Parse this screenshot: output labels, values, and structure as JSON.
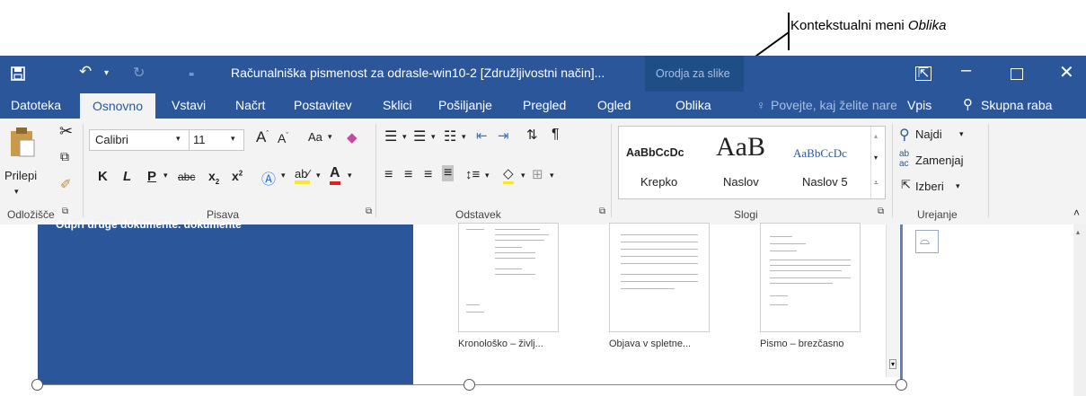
{
  "callout": {
    "prefix": "Kontekstualni meni ",
    "emphasis": "Oblika"
  },
  "titlebar": {
    "save_icon": "save-icon",
    "doc_title": "Računalniška pismenost za odrasle-win10-2 [Združljivostni način]...",
    "context_tools": "Orodja za slike",
    "window_controls": [
      "ribbon-display-icon",
      "minimize-icon",
      "maximize-icon",
      "close-icon"
    ]
  },
  "tabs": {
    "items": [
      "Datoteka",
      "Osnovno",
      "Vstavi",
      "Načrt",
      "Postavitev",
      "Sklici",
      "Pošiljanje",
      "Pregled",
      "Ogled",
      "Oblika"
    ],
    "active": "Osnovno",
    "tell_me": "Povejte, kaj želite narediti",
    "user": "Vpis",
    "share": "Skupna raba"
  },
  "clipboard": {
    "paste": "Prilepi",
    "group": "Odložišče"
  },
  "font": {
    "name": "Calibri",
    "size": "11",
    "case": "Aa",
    "bold": "K",
    "italic": "L",
    "underline": "P",
    "strike": "abc",
    "sub": "x",
    "sup": "x",
    "group": "Pisava"
  },
  "paragraph": {
    "group": "Odstavek"
  },
  "styles": {
    "items": [
      {
        "preview": "AaBbCcDc",
        "name": "Krepko"
      },
      {
        "preview": "AaB",
        "name": "Naslov"
      },
      {
        "preview": "AaBbCcDc",
        "name": "Naslov 5"
      }
    ],
    "group": "Slogi"
  },
  "editing": {
    "find": "Najdi",
    "replace": "Zamenjaj",
    "select": "Izberi",
    "group": "Urejanje"
  },
  "document": {
    "panel_text": "Odpri druge dokumente. dokumente",
    "templates": [
      "Kronološko – življ...",
      "Objava v spletne...",
      "Pismo – brezčasno"
    ]
  }
}
